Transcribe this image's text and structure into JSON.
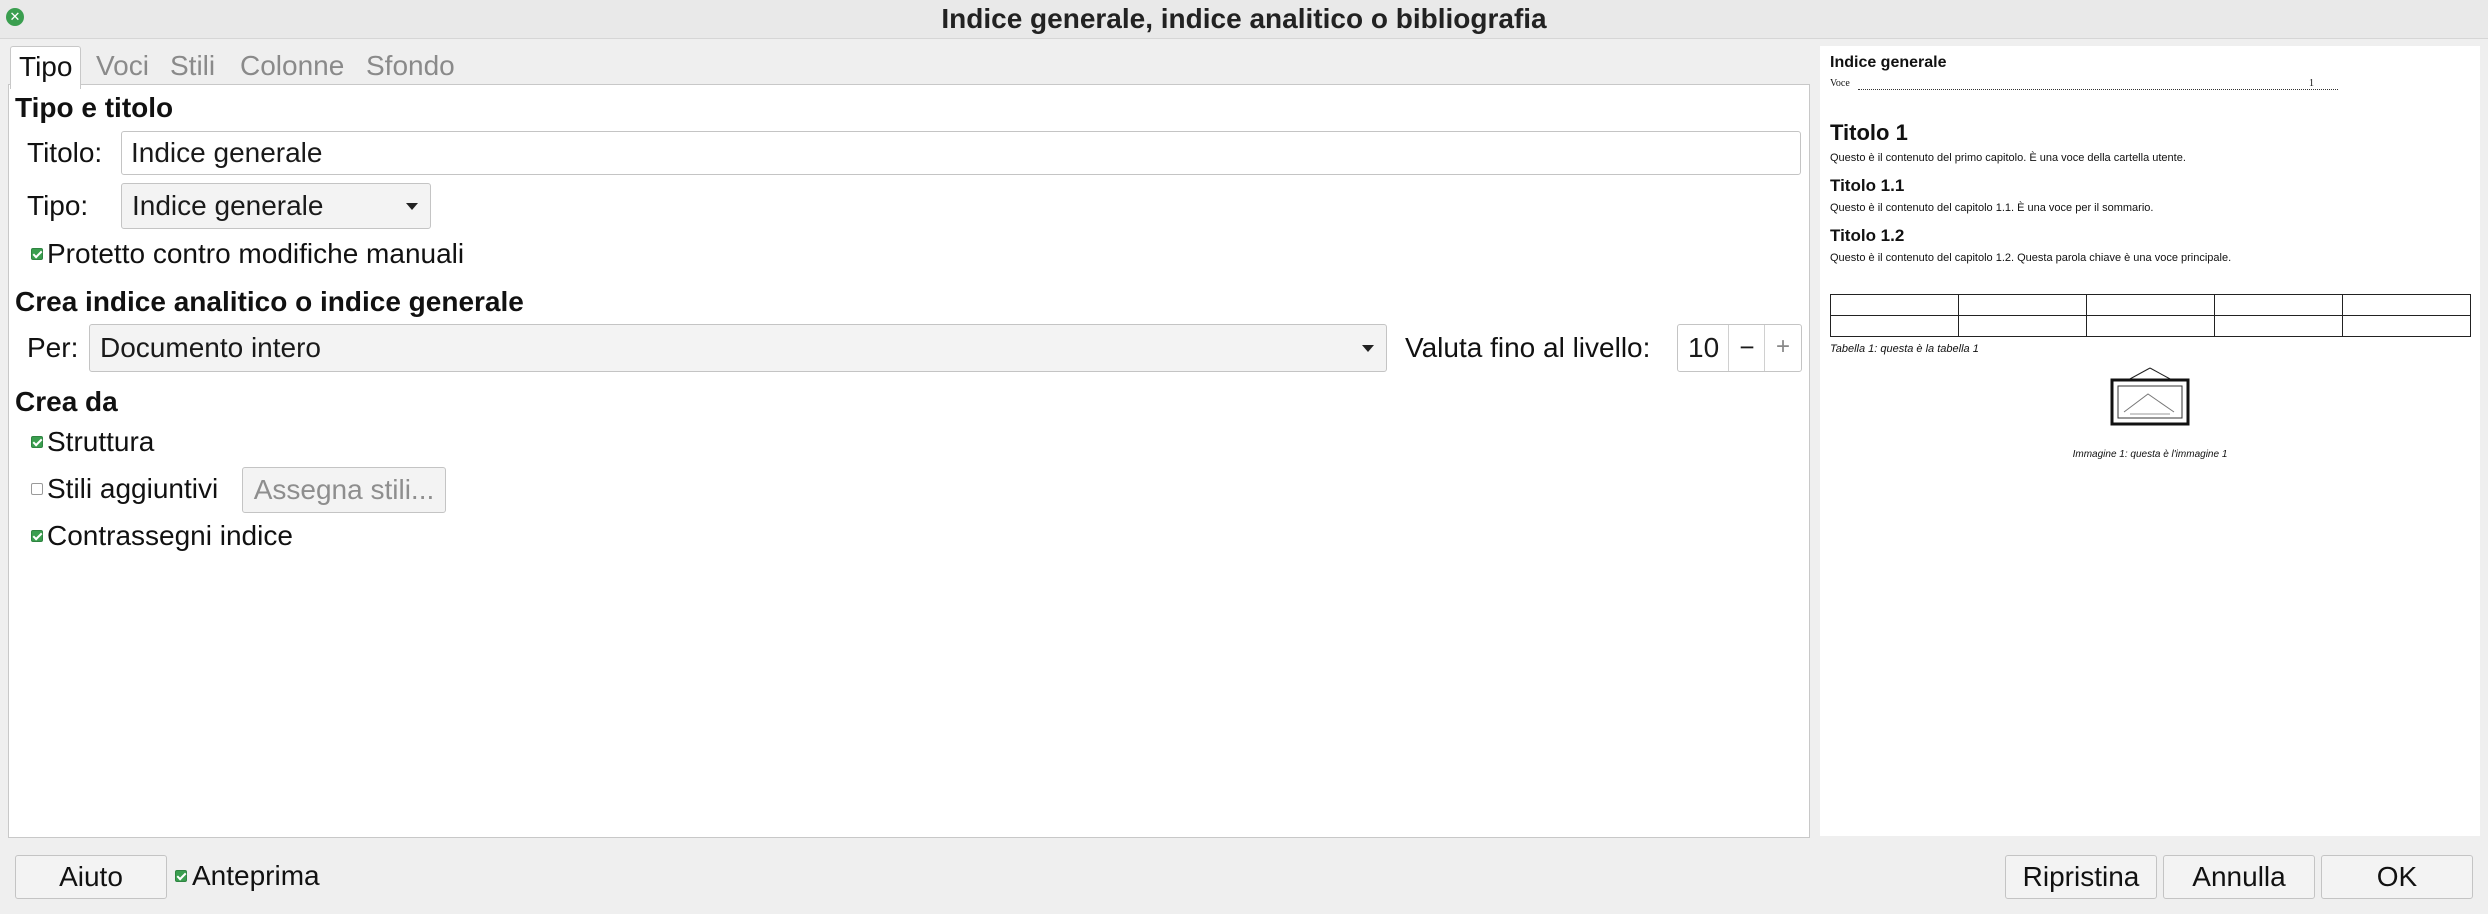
{
  "window": {
    "title": "Indice generale, indice analitico o bibliografia"
  },
  "tabs": [
    {
      "label": "Tipo",
      "active": true
    },
    {
      "label": "Voci",
      "active": false
    },
    {
      "label": "Stili",
      "active": false
    },
    {
      "label": "Colonne",
      "active": false
    },
    {
      "label": "Sfondo",
      "active": false
    }
  ],
  "type_title": {
    "heading": "Tipo e titolo",
    "title_label": "Titolo:",
    "title_value": "Indice generale",
    "type_label": "Tipo:",
    "type_value": "Indice generale",
    "protected_label": "Protetto contro modifiche manuali",
    "protected_checked": true
  },
  "create_index": {
    "heading": "Crea indice analitico o indice generale",
    "for_label": "Per:",
    "for_value": "Documento intero",
    "level_label": "Valuta fino al livello:",
    "level_value": "10",
    "minus_label": "−",
    "plus_label": "+"
  },
  "create_from": {
    "heading": "Crea da",
    "outline_label": "Struttura",
    "outline_checked": true,
    "additional_styles_label": "Stili aggiuntivi",
    "additional_styles_checked": false,
    "assign_styles_label": "Assegna stili...",
    "index_marks_label": "Contrassegni indice",
    "index_marks_checked": true
  },
  "preview": {
    "toc_title": "Indice generale",
    "toc_entry": "Voce",
    "toc_page": "1",
    "h1": "Titolo 1",
    "p1": "Questo è il contenuto del primo capitolo. È una voce della cartella utente.",
    "h11": "Titolo 1.1",
    "p11": "Questo è il contenuto del capitolo 1.1. È una voce per il sommario.",
    "h12": "Titolo 1.2",
    "p12": "Questo è il contenuto del capitolo 1.2. Questa parola chiave è una voce principale.",
    "table_caption": "Tabella 1: questa è la tabella 1",
    "image_caption": "Immagine 1: questa è l'immagine 1"
  },
  "footer": {
    "help_label": "Aiuto",
    "preview_label": "Anteprima",
    "preview_checked": true,
    "reset_label": "Ripristina",
    "cancel_label": "Annulla",
    "ok_label": "OK"
  },
  "colors": {
    "accent": "#3a9e4f",
    "panel_bg": "#ffffff",
    "window_bg": "#efefef"
  }
}
